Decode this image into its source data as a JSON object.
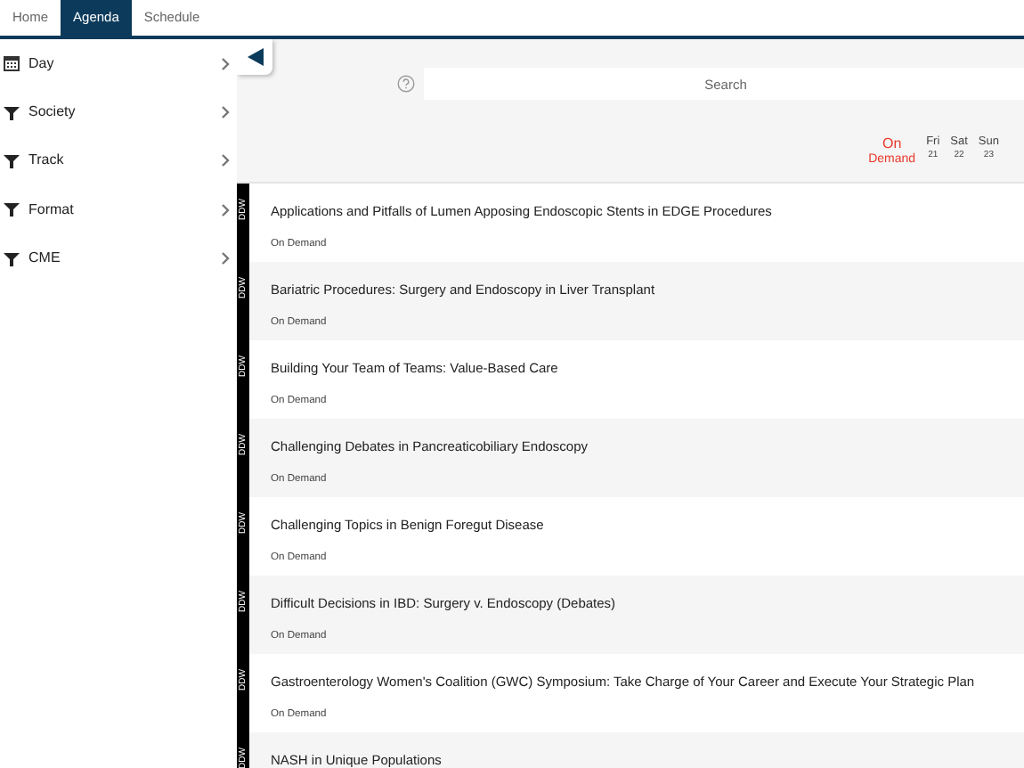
{
  "tabs": [
    {
      "label": "Home",
      "selected": false
    },
    {
      "label": "Agenda",
      "selected": true
    },
    {
      "label": "Schedule",
      "selected": false
    }
  ],
  "filters": [
    {
      "label": "Day",
      "kind": "calendar"
    },
    {
      "label": "Society",
      "kind": "filter"
    },
    {
      "label": "Track",
      "kind": "filter"
    },
    {
      "label": "Format",
      "kind": "filter"
    },
    {
      "label": "CME",
      "kind": "filter"
    }
  ],
  "search": {
    "placeholder": "Search"
  },
  "days": [
    {
      "label": "On",
      "sub": "Demand",
      "selected": true
    },
    {
      "label": "Fri",
      "sub": "21",
      "selected": false
    },
    {
      "label": "Sat",
      "sub": "22",
      "selected": false
    },
    {
      "label": "Sun",
      "sub": "23",
      "selected": false
    }
  ],
  "sessions": [
    {
      "tag": "DDW",
      "title": "Applications and Pitfalls of Lumen Apposing Endoscopic Stents in EDGE Procedures",
      "time": "On Demand"
    },
    {
      "tag": "DDW",
      "title": "Bariatric Procedures: Surgery and Endoscopy in Liver Transplant",
      "time": "On Demand"
    },
    {
      "tag": "DDW",
      "title": "Building Your Team of Teams: Value-Based Care",
      "time": "On Demand"
    },
    {
      "tag": "DDW",
      "title": "Challenging Debates in Pancreaticobiliary Endoscopy",
      "time": "On Demand"
    },
    {
      "tag": "DDW",
      "title": "Challenging Topics in Benign Foregut Disease",
      "time": "On Demand"
    },
    {
      "tag": "DDW",
      "title": "Difficult Decisions in IBD: Surgery v. Endoscopy (Debates)",
      "time": "On Demand"
    },
    {
      "tag": "DDW",
      "title": "Gastroenterology Women's Coalition (GWC) Symposium: Take Charge of Your Career and Execute Your Strategic Plan",
      "time": "On Demand"
    },
    {
      "tag": "DDW",
      "title": "NASH in Unique Populations"
    }
  ]
}
